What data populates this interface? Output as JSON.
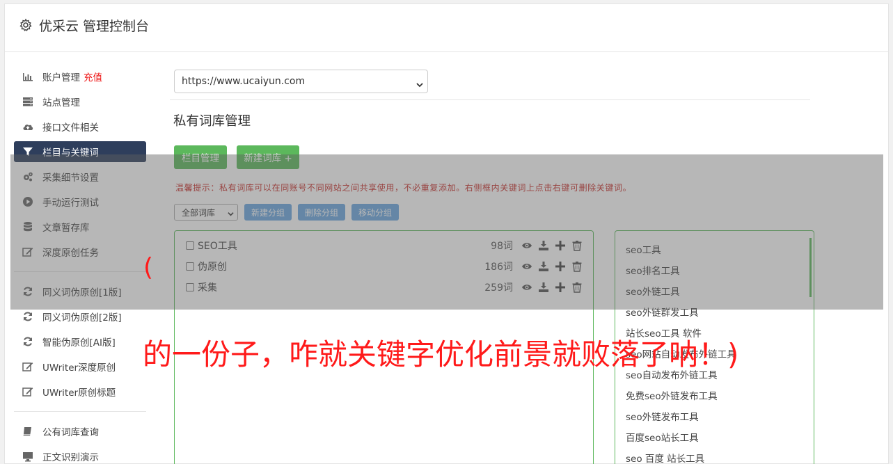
{
  "header": {
    "title": "优采云 管理控制台",
    "icon": "gear-icon"
  },
  "sidebar": {
    "items": [
      {
        "label": "账户管理",
        "badge": "充值",
        "icon": "bar-chart-icon"
      },
      {
        "label": "站点管理",
        "icon": "server-icon"
      },
      {
        "label": "接口文件相关",
        "icon": "cloud-upload-icon"
      },
      {
        "label": "栏目与关键词",
        "icon": "filter-icon",
        "active": true
      },
      {
        "label": "采集细节设置",
        "icon": "cogs-icon"
      },
      {
        "label": "手动运行测试",
        "icon": "play-circle-icon"
      },
      {
        "label": "文章暂存库",
        "icon": "database-icon"
      },
      {
        "label": "深度原创任务",
        "icon": "edit-icon"
      }
    ],
    "items2": [
      {
        "label": "同义词伪原创[1版]",
        "icon": "refresh-icon"
      },
      {
        "label": "同义词伪原创[2版]",
        "icon": "refresh-icon"
      },
      {
        "label": "智能伪原创[AI版]",
        "icon": "refresh-icon"
      },
      {
        "label": "UWriter深度原创",
        "icon": "edit-icon"
      },
      {
        "label": "UWriter原创标题",
        "icon": "edit-icon"
      }
    ],
    "items3": [
      {
        "label": "公有词库查询",
        "icon": "book-icon"
      },
      {
        "label": "正文识别演示",
        "icon": "monitor-icon"
      }
    ]
  },
  "main": {
    "site_select": "https://www.ucaiyun.com",
    "section_title": "私有词库管理",
    "buttons": {
      "column_manage": "栏目管理",
      "new_library": "新建词库 +"
    },
    "tip": "温馨提示：私有词库可以在同账号不同网站之间共享使用，不必重复添加。右侧框内关键词上点击右键可删除关键词。",
    "group_select": "全部词库",
    "group_buttons": {
      "new": "新建分组",
      "delete": "删除分组",
      "move": "移动分组"
    },
    "libraries": [
      {
        "name": "SEO工具",
        "count": "98词"
      },
      {
        "name": "伪原创",
        "count": "186词"
      },
      {
        "name": "采集",
        "count": "259词"
      }
    ],
    "keywords": [
      "seo工具",
      "seo排名工具",
      "seo外链工具",
      "seo外链群发工具",
      "站长seo工具 软件",
      "seo网站自动发布外链工具",
      "seo自动发布外链工具",
      "免费seo外链发布工具",
      "seo外链发布工具",
      "百度seo站长工具",
      "seo 百度 站长工具"
    ]
  },
  "overlay": {
    "paren": "(",
    "caption": "的一份子，咋就关键字优化前景就败落了呐！)"
  },
  "colors": {
    "green": "#5cb85c",
    "navy": "#2e3e5c",
    "red": "#ff1a1a",
    "blue": "#6aa7e0"
  }
}
